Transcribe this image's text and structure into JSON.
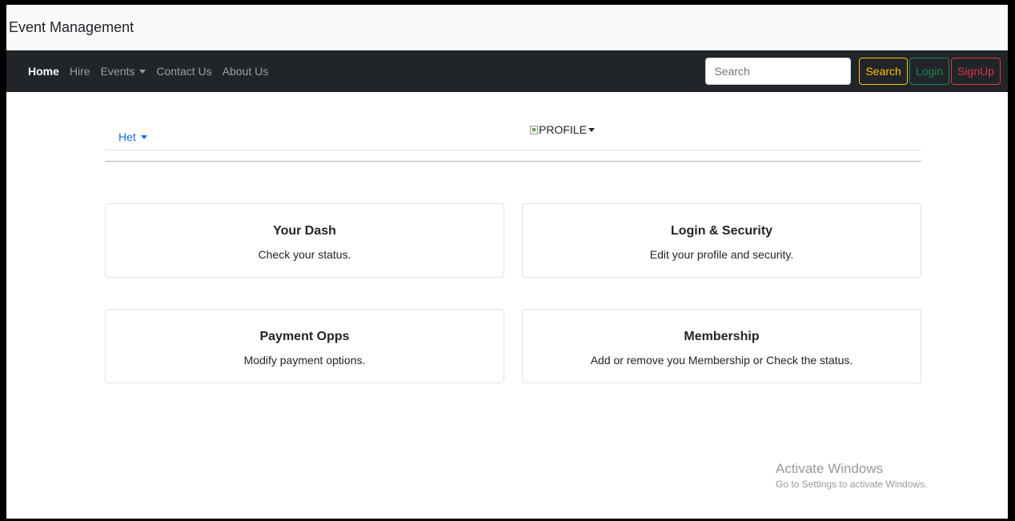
{
  "brand": "Event Management",
  "nav": {
    "home": "Home",
    "hire": "Hire",
    "events": "Events",
    "contact": "Contact Us",
    "about": "About Us"
  },
  "search": {
    "placeholder": "Search",
    "value": ""
  },
  "buttons": {
    "search": "Search",
    "login": "Login",
    "signup": "SignUp"
  },
  "subnav": {
    "user": "Het",
    "profile_alt": "PROFILE"
  },
  "cards": [
    {
      "title": "Your Dash",
      "text": "Check your status."
    },
    {
      "title": "Login & Security",
      "text": "Edit your profile and security."
    },
    {
      "title": "Payment Opps",
      "text": "Modify payment options."
    },
    {
      "title": "Membership",
      "text": "Add or remove you Membership or Check the status."
    }
  ],
  "watermark": {
    "title": "Activate Windows",
    "subtitle": "Go to Settings to activate Windows."
  },
  "colors": {
    "navbar": "#212529",
    "link": "#0d6efd",
    "warning": "#ffc107",
    "success": "#198754",
    "danger": "#dc3545"
  }
}
